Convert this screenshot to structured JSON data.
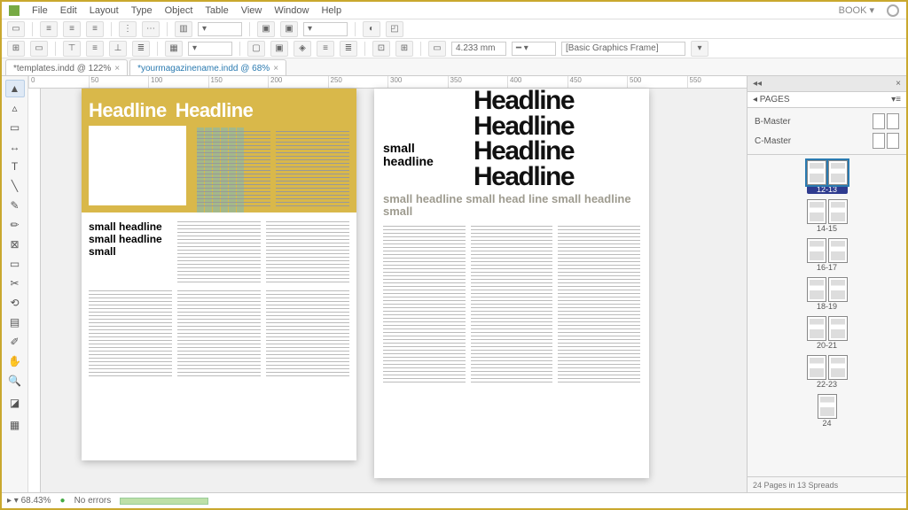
{
  "menu": [
    "File",
    "Edit",
    "Layout",
    "Type",
    "Object",
    "Table",
    "View",
    "Window",
    "Help"
  ],
  "book_label": "BOOK ▾",
  "toolbar2": {
    "measure": "4.233 mm",
    "style_field": "[Basic Graphics Frame]"
  },
  "tabs": [
    {
      "label": "*templates.indd @ 122%",
      "active": true
    },
    {
      "label": "*yourmagazinename.indd @ 68%",
      "active": false
    }
  ],
  "ruler_ticks": [
    "0",
    "50",
    "100",
    "150",
    "200",
    "250",
    "300",
    "350",
    "400",
    "450",
    "500",
    "550"
  ],
  "left_page": {
    "hero_words": [
      "Headline",
      "Headline"
    ],
    "small_stack": "small headline small headline small"
  },
  "right_page": {
    "big_lines": [
      "Headline",
      "Headline",
      "Headline",
      "Headline"
    ],
    "small": "small headline",
    "sub": "small headline small head line small headline small"
  },
  "panel": {
    "title": "◂ PAGES",
    "masters": [
      "B-Master",
      "C-Master"
    ],
    "spreads": [
      "12-13",
      "14-15",
      "16-17",
      "18-19",
      "20-21",
      "22-23",
      "24"
    ],
    "selected": "12-13",
    "footer": "24 Pages in 13 Spreads"
  },
  "status": {
    "zoom": "▸ ▾ 68.43%",
    "errors": "No errors"
  }
}
